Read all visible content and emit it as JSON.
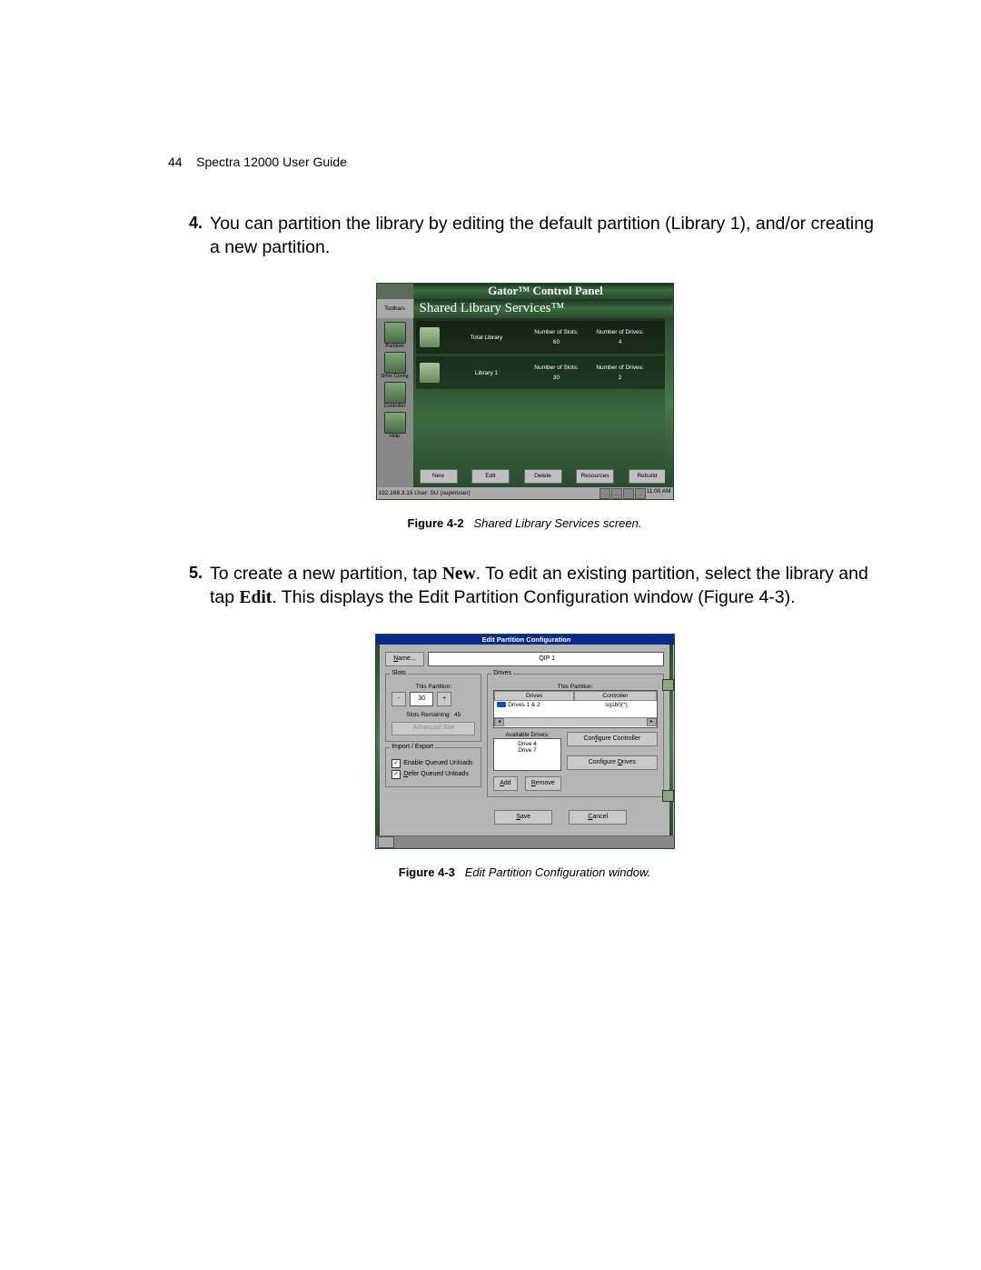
{
  "header": {
    "page_num": "44",
    "title": "Spectra 12000 User Guide"
  },
  "item4": {
    "num": "4.",
    "text": "You can partition the library by editing the default partition (Library 1), and/or creating a new partition."
  },
  "item5": {
    "num": "5.",
    "pre": "To create a new partition, tap ",
    "new": "New",
    "mid1": ". To edit an existing partition, select the library and tap ",
    "edit": "Edit",
    "mid2": ". This displays the Edit Partition Configuration window (Figure 4-3)."
  },
  "fig1": {
    "label": "Figure 4-2",
    "caption": "Shared Library Services screen."
  },
  "fig2": {
    "label": "Figure 4-3",
    "caption": "Edit Partition Configuration window."
  },
  "shot1": {
    "title": "Gator™ Control Panel",
    "toolbars": "Toolbars",
    "subtitle": "Shared Library Services™",
    "left": [
      "Partition",
      "Drive Config",
      "Controller",
      "Help"
    ],
    "col_slots": "Number of Slots:",
    "col_drives": "Number of Drives:",
    "rows": [
      {
        "label": "Total Library",
        "slots": "60",
        "drives": "4"
      },
      {
        "label": "Library 1",
        "slots": "30",
        "drives": "2"
      }
    ],
    "buttons": [
      "New",
      "Edit",
      "Delete",
      "Resources",
      "Rebuild"
    ],
    "status_left": "192.168.3.15 User: SU (superuser)",
    "status_time": "11:00 AM"
  },
  "shot2": {
    "title": "Edit Partition Configuration",
    "name_btn": "Name...",
    "name_value": "QIP 1",
    "slots": {
      "legend": "Slots",
      "this_partition": "This Partition:",
      "minus": "-",
      "value": "30",
      "plus": "+",
      "remaining_lbl": "Slots Remaining:",
      "remaining_val": "45",
      "advanced": "Advanced Slot"
    },
    "ie": {
      "legend": "Import / Export",
      "enable": "Enable Queued Unloads",
      "defer": "Defer Queued Unloads"
    },
    "drives": {
      "legend": "Drives",
      "this_partition": "This Partition:",
      "h1": "Drives",
      "h2": "Controller",
      "row1_d": "Drives 1 & 2",
      "row1_c": "sq1b0(*)",
      "avail": "Available Drives:",
      "d1": "Drive 4",
      "d2": "Drive 7",
      "add": "Add",
      "remove": "Remove",
      "cfg_ctrl": "Configure Controller",
      "cfg_drv": "Configure Drives"
    },
    "save": "Save",
    "cancel": "Cancel"
  }
}
